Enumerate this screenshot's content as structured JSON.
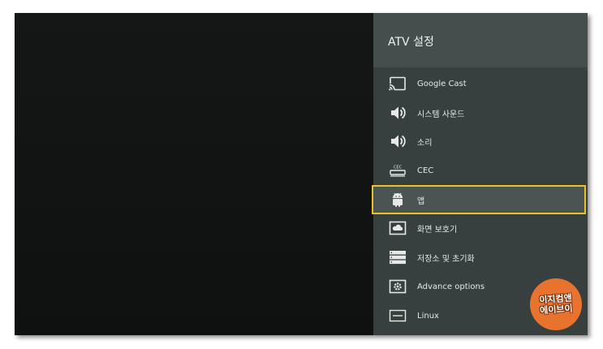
{
  "panel": {
    "title": "ATV 설정",
    "items": [
      {
        "label": "Google Cast",
        "icon": "cast-icon"
      },
      {
        "label": "시스템 사운드",
        "icon": "speaker-icon"
      },
      {
        "label": "소리",
        "icon": "speaker-icon"
      },
      {
        "label": "CEC",
        "icon": "cec-icon"
      },
      {
        "label": "앱",
        "icon": "android-icon"
      },
      {
        "label": "화면 보호기",
        "icon": "screensaver-icon"
      },
      {
        "label": "저장소 및 초기화",
        "icon": "storage-icon"
      },
      {
        "label": "Advance options",
        "icon": "settings-box-icon"
      },
      {
        "label": "Linux",
        "icon": "linux-icon"
      }
    ],
    "selected_index": 4
  },
  "watermark": {
    "line1": "이지컴앤",
    "line2": "에이브이"
  },
  "colors": {
    "panel": "#37403f",
    "header": "#444e4d",
    "selection_border": "#e8c22a",
    "badge": "#e8732f"
  }
}
